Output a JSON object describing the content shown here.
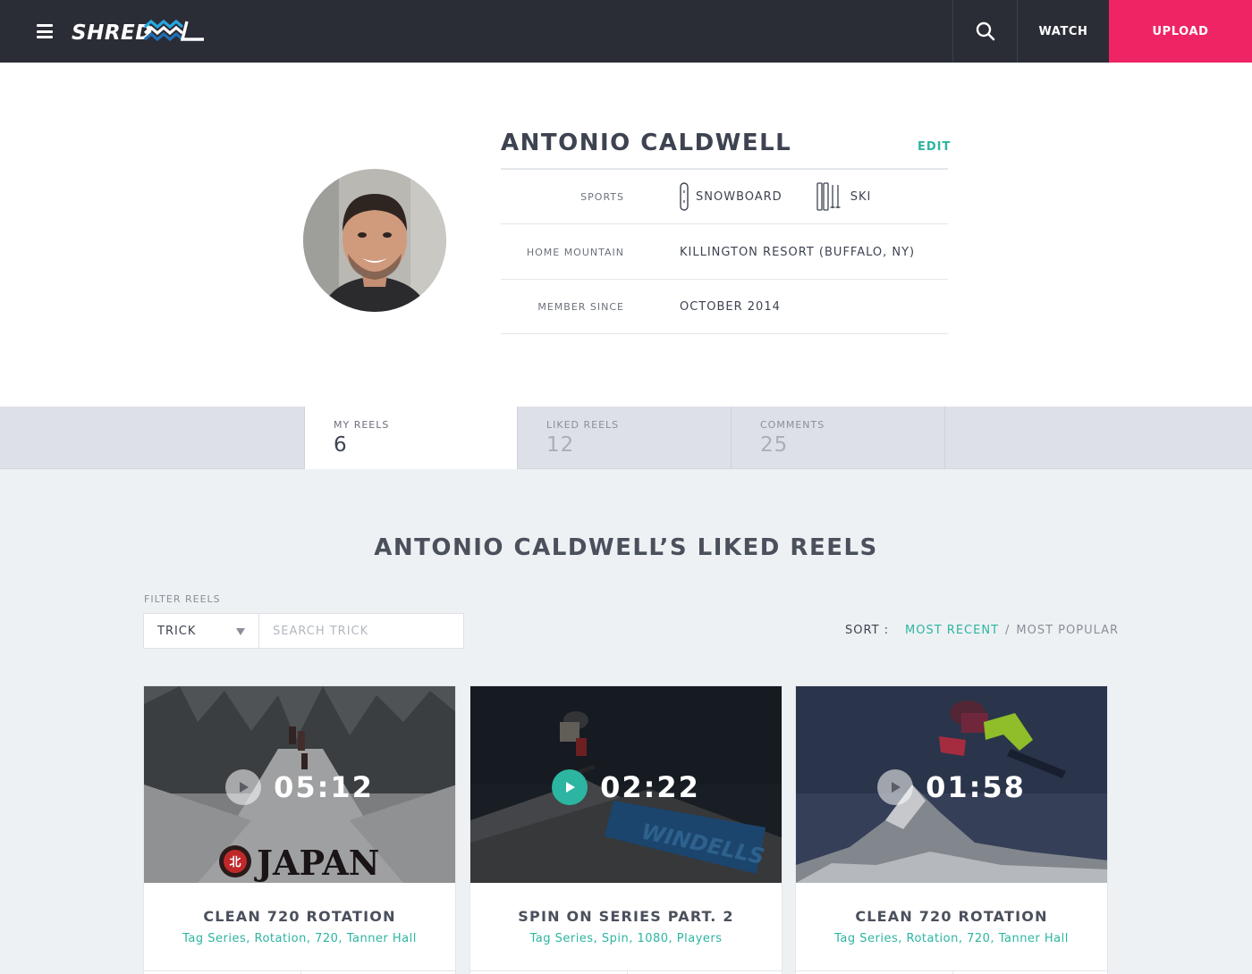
{
  "header": {
    "brand": "SHREDREEL",
    "watch_label": "WATCH",
    "upload_label": "UPLOAD"
  },
  "profile": {
    "name": "ANTONIO CALDWELL",
    "edit_label": "EDIT",
    "sports_label": "SPORTS",
    "sports": [
      "SNOWBOARD",
      "SKI"
    ],
    "home_mountain_label": "HOME MOUNTAIN",
    "home_mountain": "KILLINGTON RESORT (BUFFALO, NY)",
    "member_since_label": "MEMBER SINCE",
    "member_since": "OCTOBER 2014"
  },
  "stats": [
    {
      "label": "MY REELS",
      "count": "6"
    },
    {
      "label": "LIKED REELS",
      "count": "12"
    },
    {
      "label": "COMMENTS",
      "count": "25"
    }
  ],
  "liked": {
    "title": "ANTONIO CALDWELL’S LIKED REELS",
    "filter_label": "FILTER REELS",
    "filter_value": "TRICK",
    "search_placeholder": "SEARCH TRICK",
    "sort_label": "SORT :",
    "sort_recent": "MOST RECENT",
    "sort_sep": "/",
    "sort_popular": "MOST POPULAR"
  },
  "reels": [
    {
      "duration": "05:12",
      "title": "CLEAN 720 ROTATION",
      "tags": "Tag Series, Rotation, 720, Tanner Hall",
      "watermark": "JAPAN"
    },
    {
      "duration": "02:22",
      "title": "SPIN ON SERIES PART. 2",
      "tags": "Tag Series, Spin, 1080, Players",
      "watermark": "WINDELLS"
    },
    {
      "duration": "01:58",
      "title": "CLEAN 720 ROTATION",
      "tags": "Tag Series, Rotation, 720, Tanner Hall"
    }
  ],
  "colors": {
    "topbar": "#2a2d36",
    "upload": "#ee2465",
    "accent": "#2cb5a0"
  }
}
